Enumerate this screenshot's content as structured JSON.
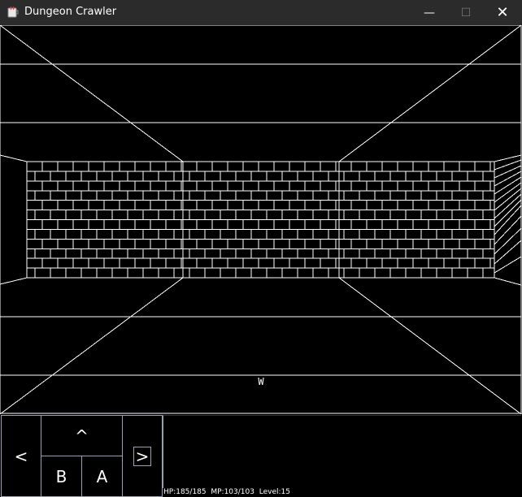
{
  "window": {
    "title": "Dungeon Crawler",
    "minimize_glyph": "—",
    "maximize_glyph": "☐",
    "close_glyph": "✕",
    "icon": "java-app-icon"
  },
  "compass": {
    "heading": "W"
  },
  "controls": {
    "turn_left": "<",
    "forward": "^",
    "turn_right": ">",
    "button_b": "B",
    "button_a": "A"
  },
  "status": {
    "hp": "HP:185/185",
    "mp": "MP:103/103",
    "level": "Level:15"
  },
  "colors": {
    "background": "#000000",
    "lines": "#ffffff",
    "titlebar": "#2b2b2b",
    "button_border": "#9aa3b5"
  }
}
